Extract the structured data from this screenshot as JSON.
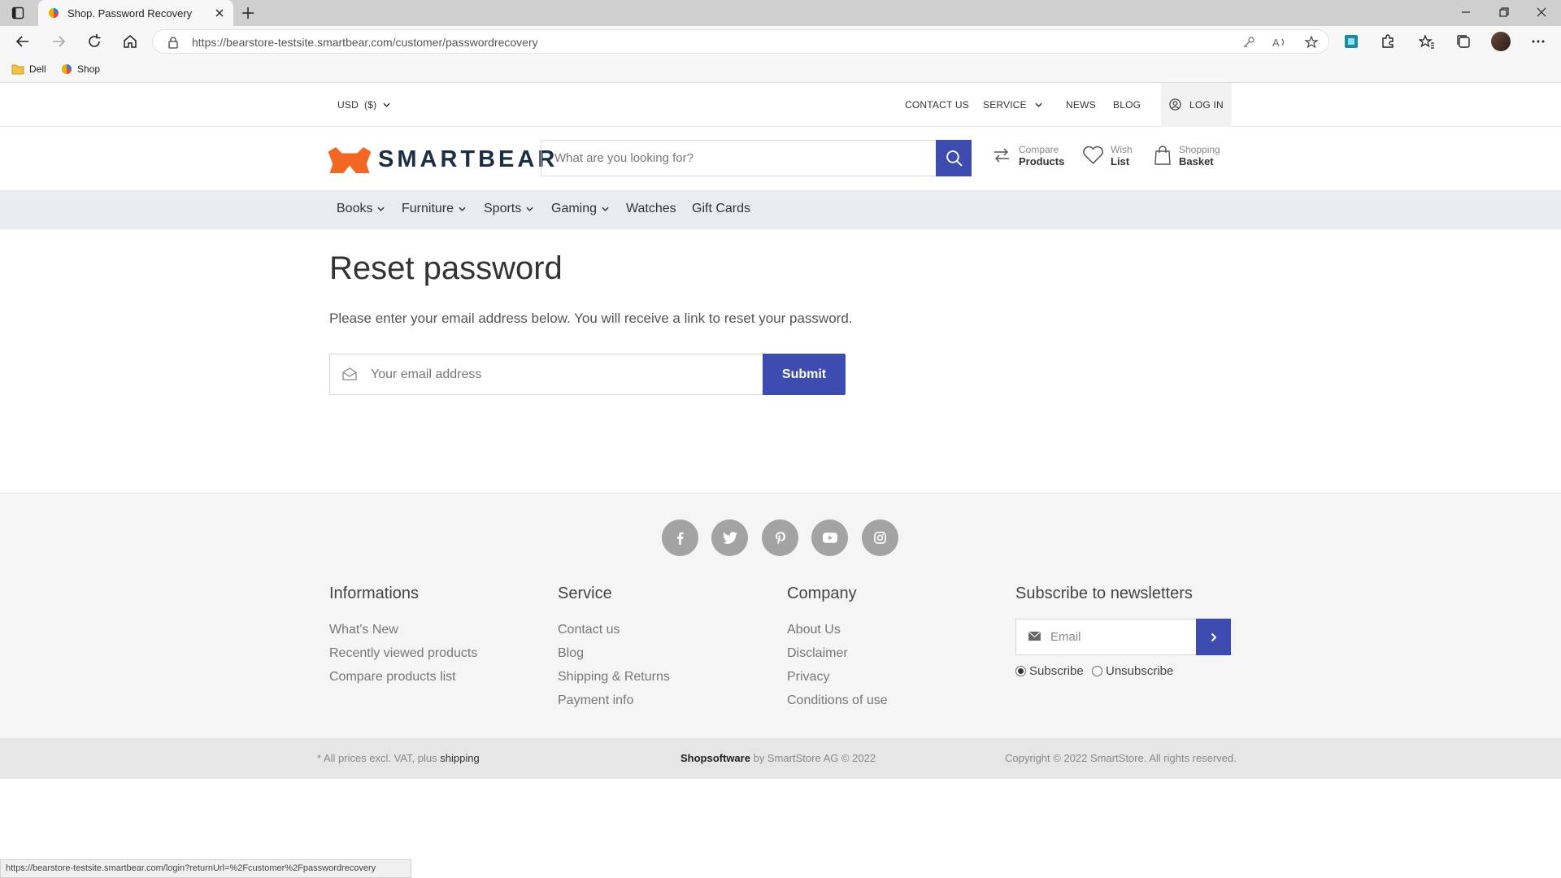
{
  "browser": {
    "tab_title": "Shop. Password Recovery",
    "url_host": "https://bearstore-testsite.smartbear.com",
    "url_path": "/customer/passwordrecovery",
    "bookmarks": [
      "Dell",
      "Shop"
    ],
    "status_url": "https://bearstore-testsite.smartbear.com/login?returnUrl=%2Fcustomer%2Fpasswordrecovery"
  },
  "topbar": {
    "currency": "USD  ($)",
    "links": [
      "CONTACT US",
      "SERVICE",
      "NEWS",
      "BLOG"
    ],
    "login": "LOG IN"
  },
  "header": {
    "logo": "SMARTBEAR",
    "search_placeholder": "What are you looking for?",
    "compare": {
      "small": "Compare",
      "big": "Products"
    },
    "wish": {
      "small": "Wish",
      "big": "List"
    },
    "basket": {
      "small": "Shopping",
      "big": "Basket"
    }
  },
  "nav": [
    "Books",
    "Furniture",
    "Sports",
    "Gaming",
    "Watches",
    "Gift Cards"
  ],
  "main": {
    "title": "Reset password",
    "description": "Please enter your email address below. You will receive a link to reset your password.",
    "email_placeholder": "Your email address",
    "submit": "Submit"
  },
  "footer": {
    "social": [
      "facebook-icon",
      "twitter-icon",
      "pinterest-icon",
      "youtube-icon",
      "instagram-icon"
    ],
    "col1": {
      "title": "Informations",
      "links": [
        "What's New",
        "Recently viewed products",
        "Compare products list"
      ]
    },
    "col2": {
      "title": "Service",
      "links": [
        "Contact us",
        "Blog",
        "Shipping & Returns",
        "Payment info"
      ]
    },
    "col3": {
      "title": "Company",
      "links": [
        "About Us",
        "Disclaimer",
        "Privacy",
        "Conditions of use"
      ]
    },
    "newsletter": {
      "title": "Subscribe to newsletters",
      "placeholder": "Email",
      "subscribe": "Subscribe",
      "unsubscribe": "Unsubscribe"
    }
  },
  "bottom": {
    "prices_prefix": "* All prices excl. VAT, plus",
    "prices_link": "shipping",
    "brand": "Shopsoftware",
    "brand_suffix": "by SmartStore AG © 2022",
    "copyright": "Copyright © 2022 SmartStore. All rights reserved."
  },
  "colors": {
    "accent": "#3e4bb0",
    "logo_orange": "#f26722"
  }
}
